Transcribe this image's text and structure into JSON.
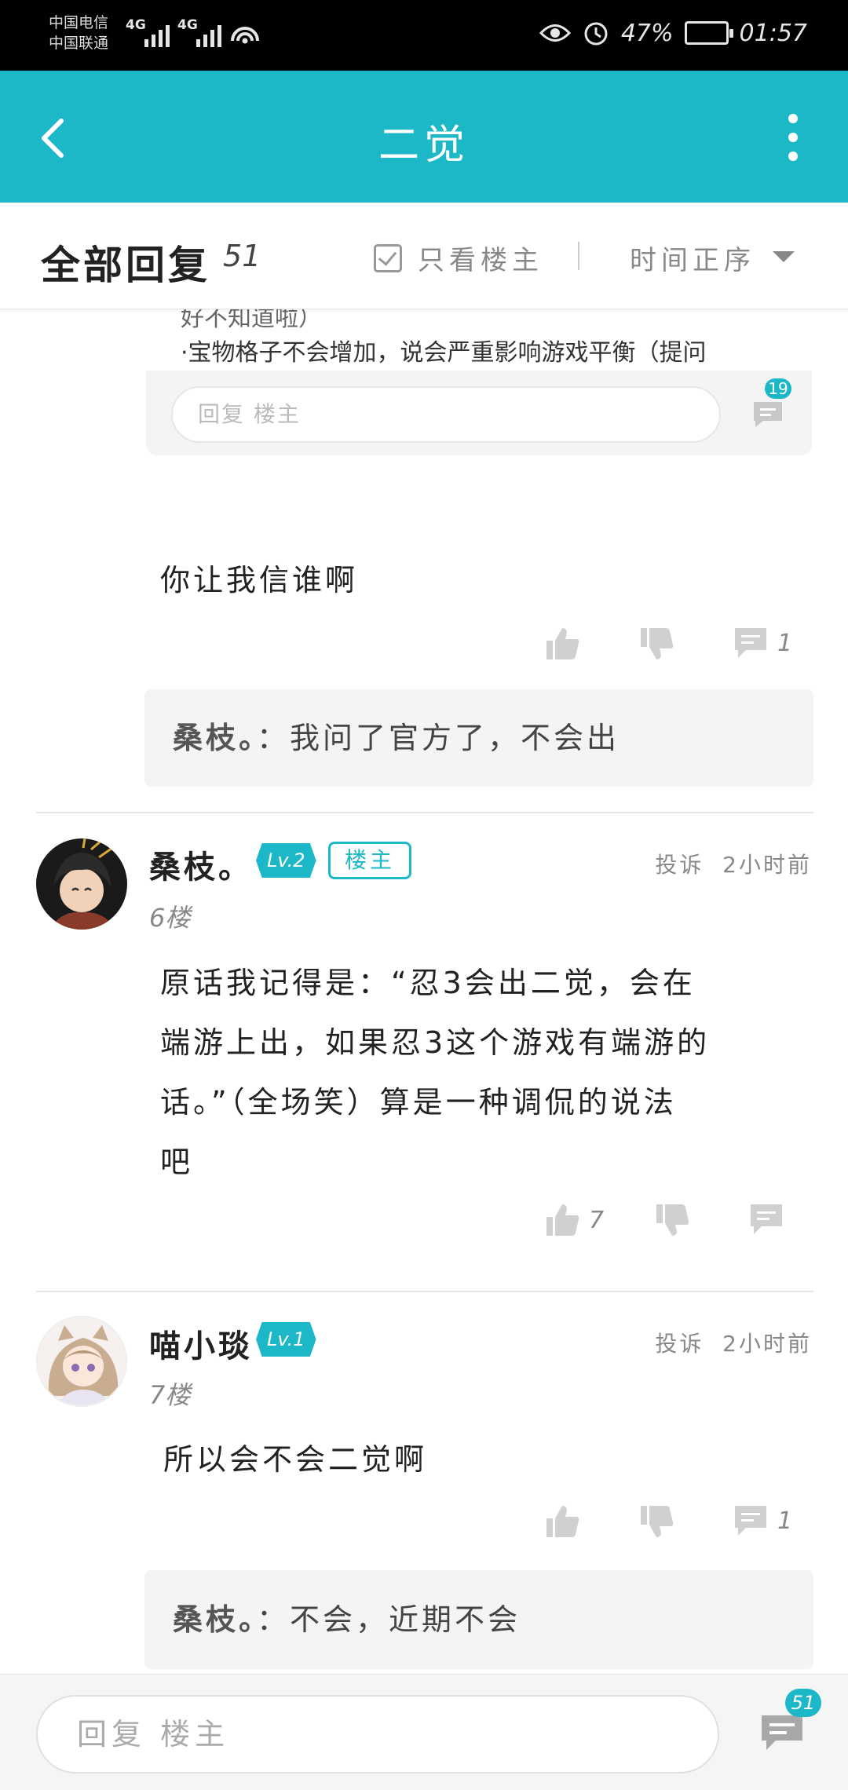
{
  "status_bar": {
    "carrier1": "中国电信",
    "carrier2": "中国联通",
    "net1": "4G",
    "net2": "4G",
    "battery": "47%",
    "time": "01:57"
  },
  "app_bar": {
    "title": "二觉"
  },
  "reply_header": {
    "label": "全部回复",
    "count": "51",
    "only_op": "只看楼主",
    "sort": "时间正序"
  },
  "prev_post": {
    "line1": "好不知道啦）",
    "line2": "·宝物格子不会增加，说会严重影响游戏平衡（提问",
    "reply_placeholder": "回复  楼主",
    "comment_count": "19"
  },
  "comments": [
    {
      "text": "你让我信谁啊",
      "likes": "",
      "replies": "1",
      "sub_reply": {
        "author": "桑枝。",
        "sep": "：",
        "text": "我问了官方了，不会出"
      }
    },
    {
      "username": "桑枝。",
      "level": "Lv.2",
      "op_tag": "楼主",
      "report": "投诉",
      "time": "2小时前",
      "floor": "6楼",
      "lines": [
        "原话我记得是：“忍3会出二觉，会在",
        "端游上出，如果忍3这个游戏有端游的",
        "话。”（全场笑）算是一种调侃的说法",
        "吧"
      ],
      "likes": "7",
      "replies": ""
    },
    {
      "username": "喵小琰",
      "level": "Lv.1",
      "report": "投诉",
      "time": "2小时前",
      "floor": "7楼",
      "text": "所以会不会二觉啊",
      "likes": "",
      "replies": "1",
      "sub_reply": {
        "author": "桑枝。",
        "sep": "：",
        "text": "不会，近期不会"
      }
    }
  ],
  "bottom_bar": {
    "placeholder": "回复  楼主",
    "comment_count": "51"
  },
  "colors": {
    "accent": "#1cb8c8",
    "status_bar": "#000000"
  }
}
